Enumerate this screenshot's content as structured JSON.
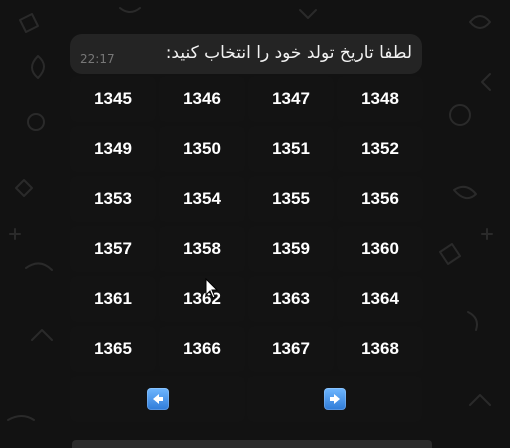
{
  "message": {
    "text": "لطفا تاریخ تولد خود را انتخاب کنید:",
    "time": "22:17"
  },
  "keyboard": {
    "years": [
      "1345",
      "1346",
      "1347",
      "1348",
      "1349",
      "1350",
      "1351",
      "1352",
      "1353",
      "1354",
      "1355",
      "1356",
      "1357",
      "1358",
      "1359",
      "1360",
      "1361",
      "1362",
      "1363",
      "1364",
      "1365",
      "1366",
      "1367",
      "1368"
    ],
    "prev_icon": "left-arrow-icon",
    "next_icon": "right-arrow-icon"
  },
  "colors": {
    "background": "#121212",
    "bubble": "#262626",
    "button": "#141414",
    "arrow": "#4a95ee"
  }
}
